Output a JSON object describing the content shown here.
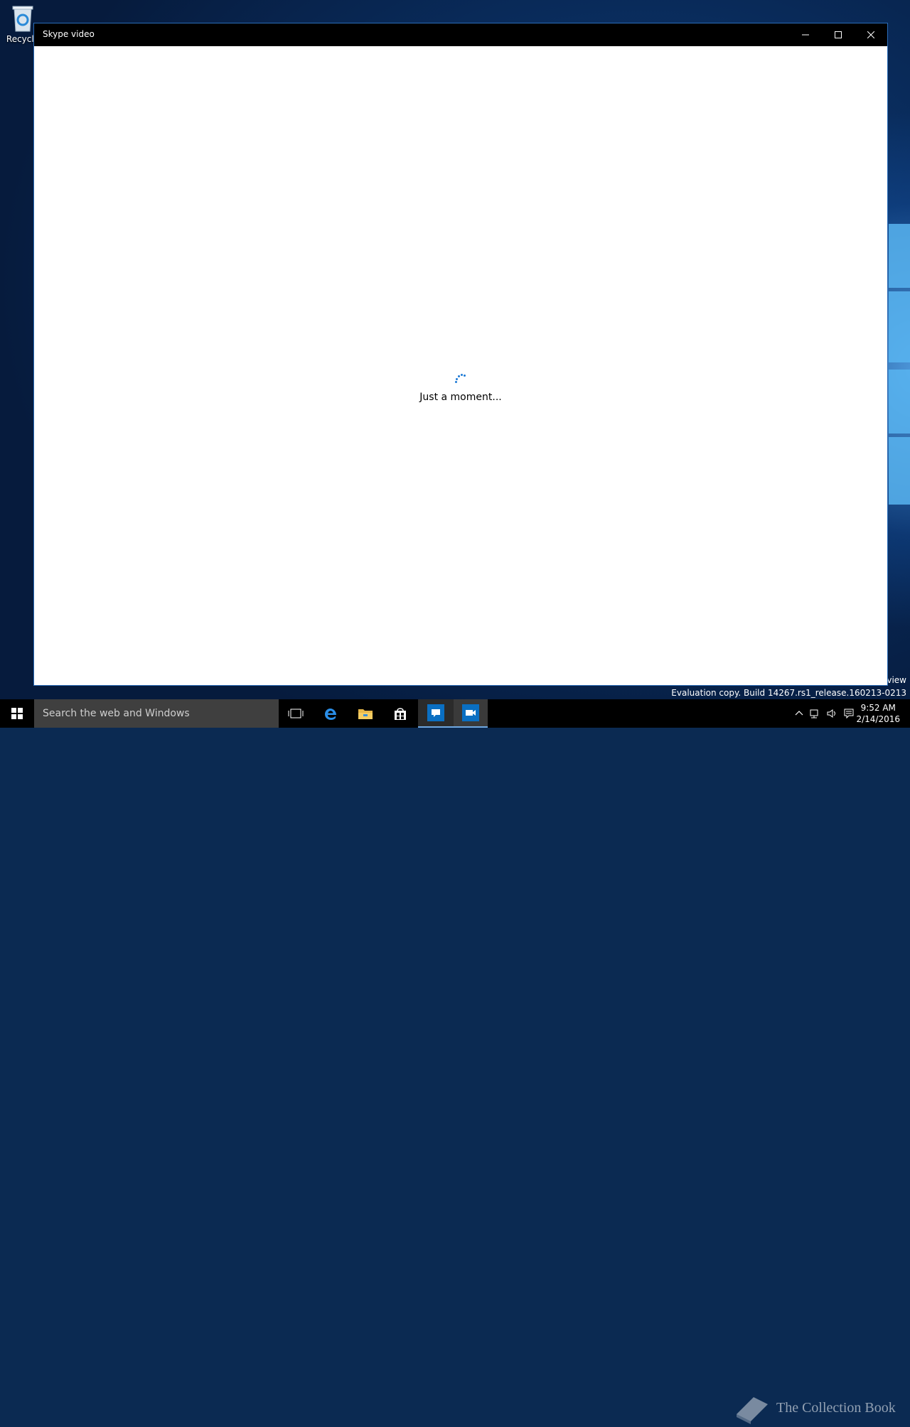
{
  "desktop": {
    "recycle_bin_label": "Recycle",
    "eval_top": "eview",
    "eval_build": "Evaluation copy. Build 14267.rs1_release.160213-0213"
  },
  "window": {
    "title": "Skype video",
    "loading_text": "Just a moment..."
  },
  "taskbar": {
    "search_placeholder": "Search the web and Windows",
    "clock_time": "9:52 AM",
    "clock_date": "2/14/2016",
    "watermark": "The Collection Book"
  },
  "colors": {
    "accent": "#1e7ad6",
    "titlebar": "#000000",
    "taskbar": "#000000"
  }
}
